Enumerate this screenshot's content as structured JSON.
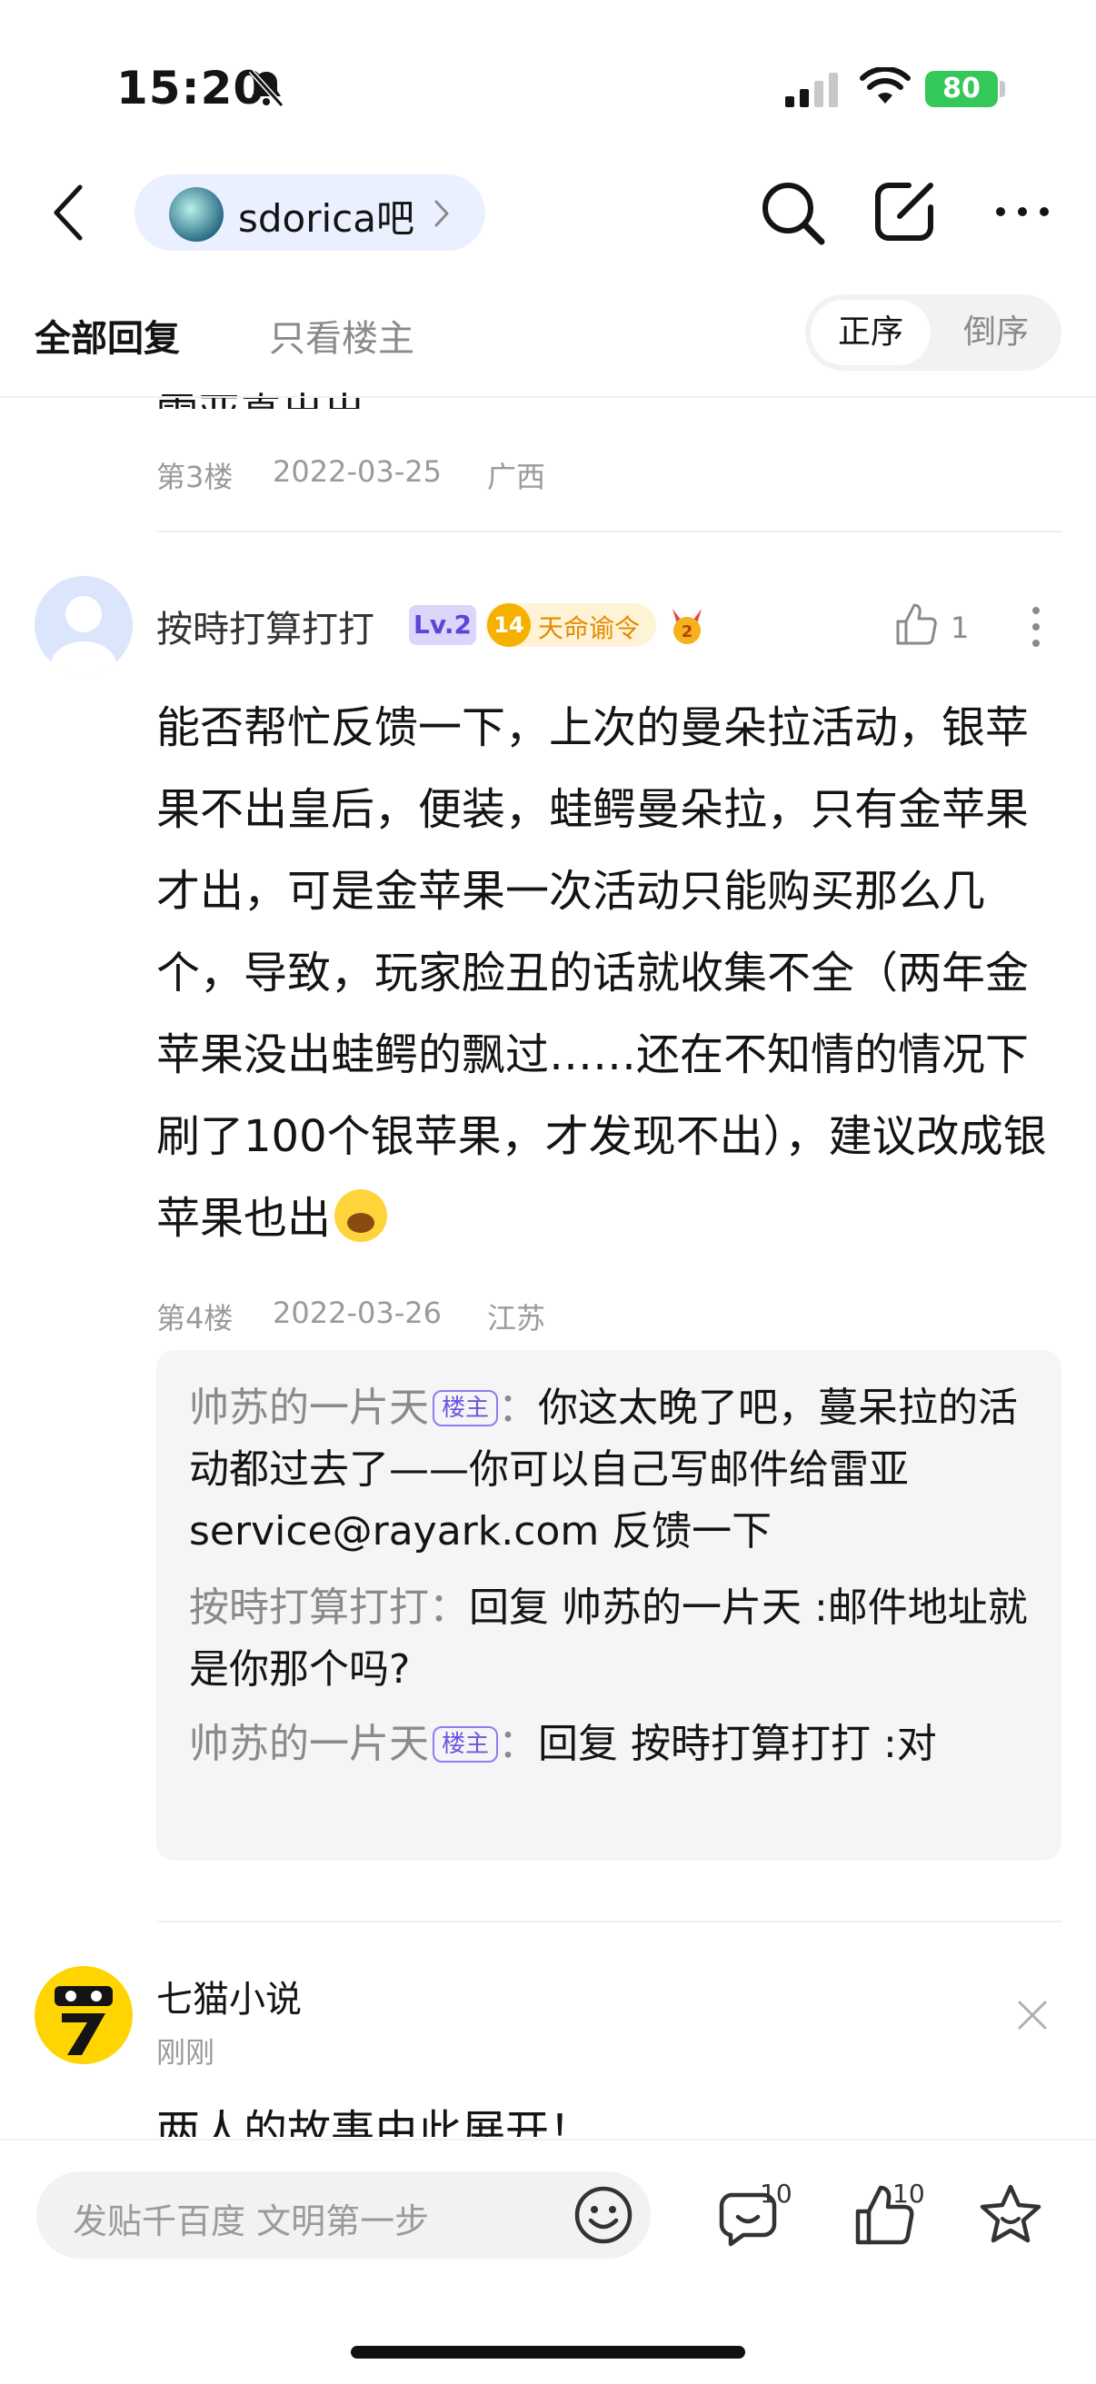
{
  "status_bar": {
    "time": "15:20",
    "battery": "80"
  },
  "nav": {
    "forum_name": "sdorica吧"
  },
  "tabs": {
    "all": "全部回复",
    "op_only": "只看楼主",
    "sort_asc": "正序",
    "sort_desc": "倒序"
  },
  "prev_post": {
    "text_tail": "雷亚真出出",
    "floor": "第3楼",
    "date": "2022-03-25",
    "location": "广西"
  },
  "post": {
    "username": "按時打算打打",
    "level": "Lv.2",
    "badge_num": "14",
    "badge_text": "天命谕令",
    "likes": "1",
    "content": "能否帮忙反馈一下，上次的曼朵拉活动，银苹果不出皇后，便装，蛙鳄曼朵拉，只有金苹果才出，可是金苹果一次活动只能购买那么几个，导致，玩家脸丑的话就收集不全（两年金苹果没出蛙鳄的飘过……还在不知情的情况下刷了100个银苹果，才发现不出），建议改成银苹果也出",
    "floor": "第4楼",
    "date": "2022-03-26",
    "location": "江苏",
    "replies": [
      {
        "name": "帅苏的一片天",
        "tag": "楼主",
        "sep": "：",
        "text": "你这太晚了吧，蔓呆拉的活动都过去了——你可以自己写邮件给雷亚 service@rayark.com 反馈一下"
      },
      {
        "name": "按時打算打打",
        "sep": "：",
        "text": "回复 帅苏的一片天 :邮件地址就是你那个吗?"
      },
      {
        "name": "帅苏的一片天",
        "tag": "楼主",
        "sep": "：",
        "text": "回复 按時打算打打 :对"
      }
    ]
  },
  "ad": {
    "name": "七猫小说",
    "time": "刚刚",
    "text": "两人的故事由此展开！"
  },
  "bottom": {
    "placeholder": "发贴千百度 文明第一步",
    "reply_count": "10",
    "like_count": "10"
  }
}
